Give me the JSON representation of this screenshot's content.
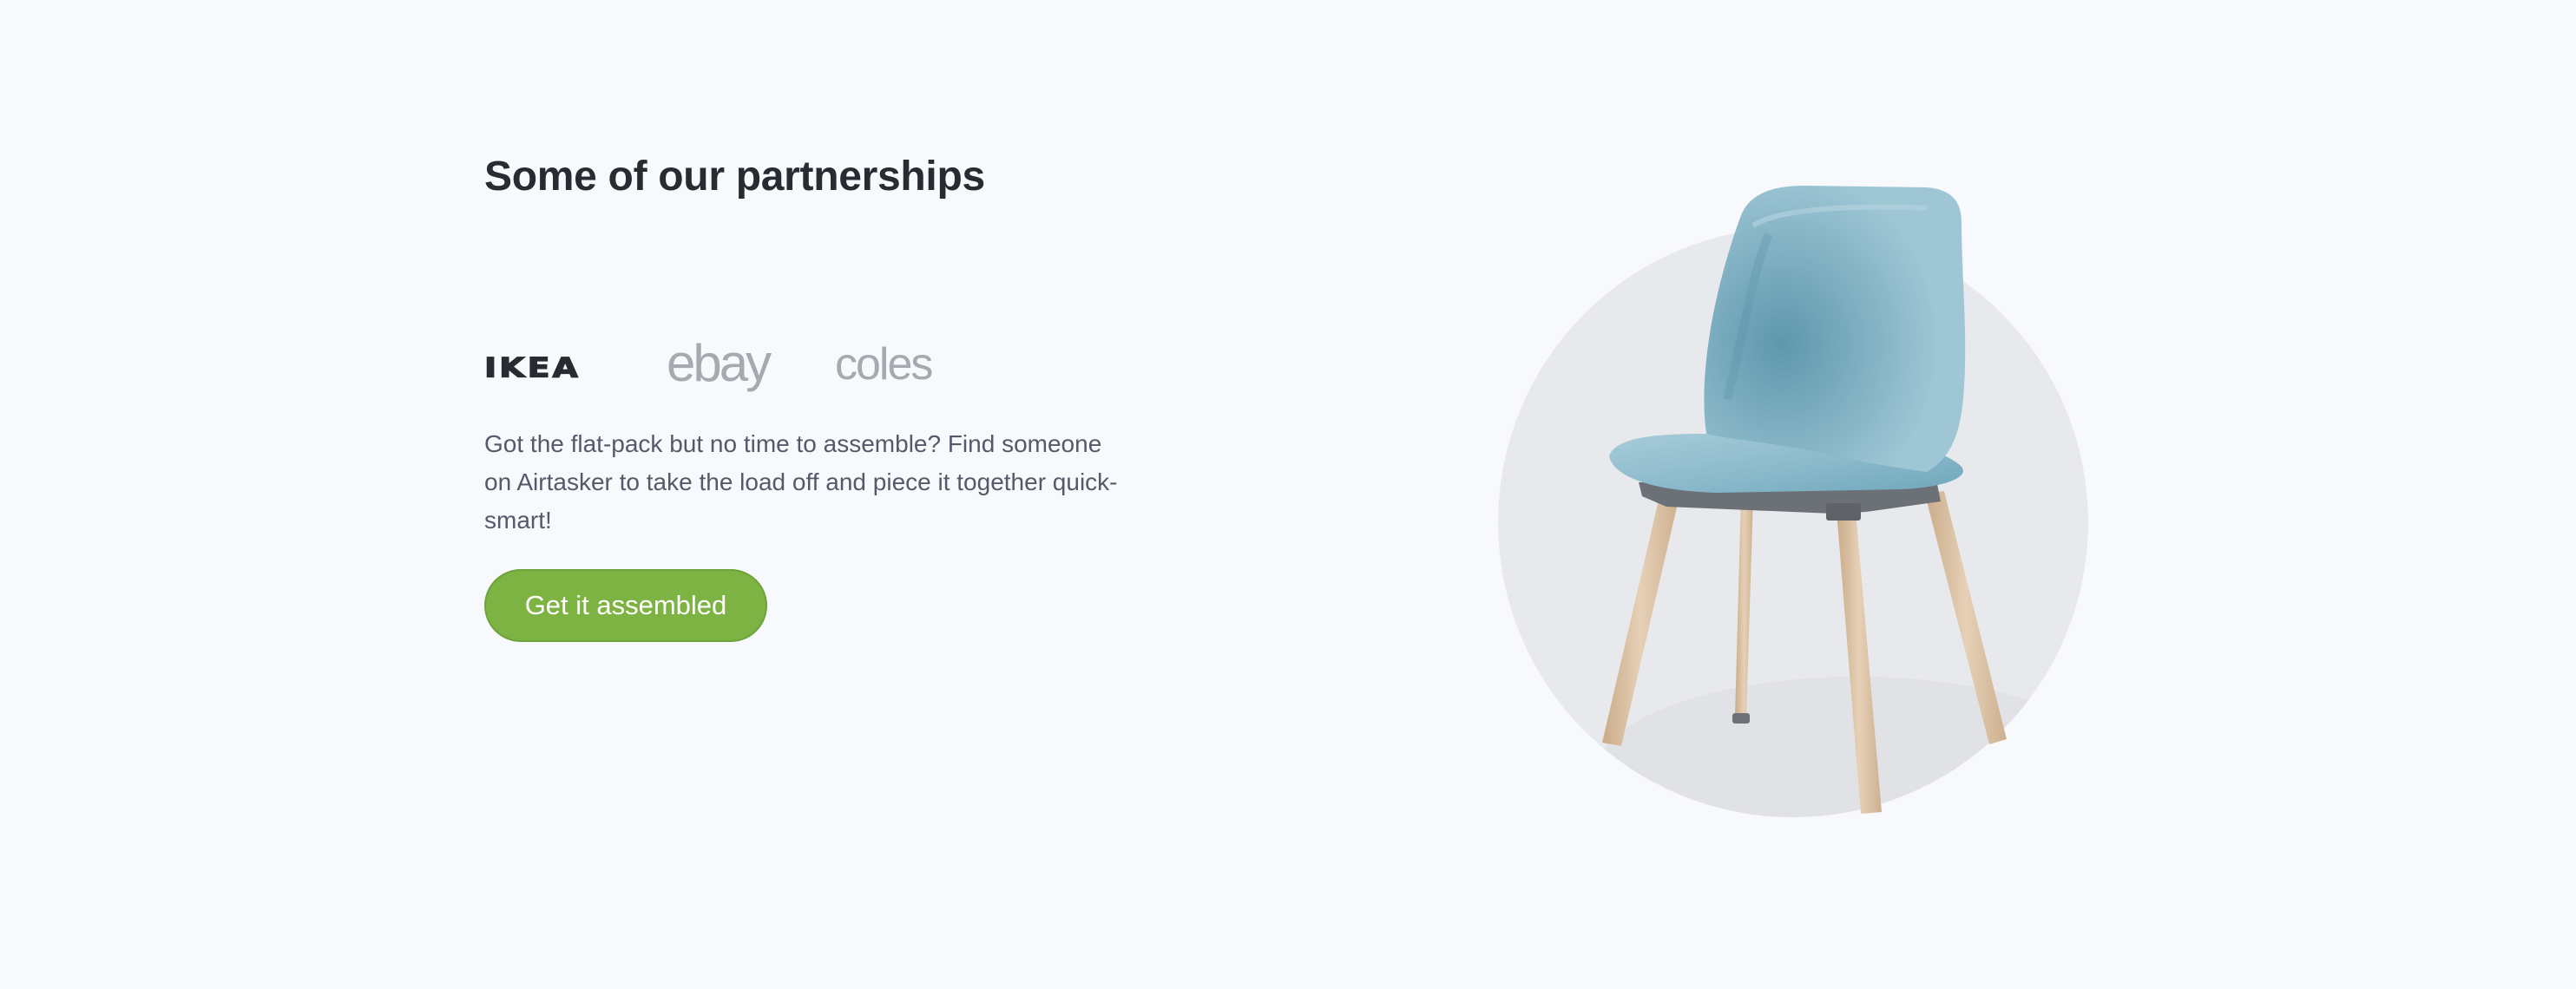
{
  "partnerships": {
    "heading": "Some of our partnerships",
    "logos": [
      {
        "name": "IKEA",
        "text": "IKEA",
        "color": "#292b32"
      },
      {
        "name": "eBay",
        "text": "ebay",
        "color": "#a7a9b0"
      },
      {
        "name": "Coles",
        "text": "coles",
        "color": "#a7a9b0"
      }
    ],
    "description": "Got the flat-pack but no time to assemble? Find someone on Airtasker to take the load off and piece it together quick-smart!",
    "cta_label": "Get it assembled",
    "illustration": "chair-illustration"
  },
  "colors": {
    "background": "#f8f9fc",
    "heading": "#292b32",
    "body_text": "#545a6a",
    "cta_background": "#7db343",
    "cta_text": "#ffffff",
    "circle": "#e8e9ed",
    "chair_seat": "#8fbccd",
    "chair_legs": "#dcc3a5"
  }
}
